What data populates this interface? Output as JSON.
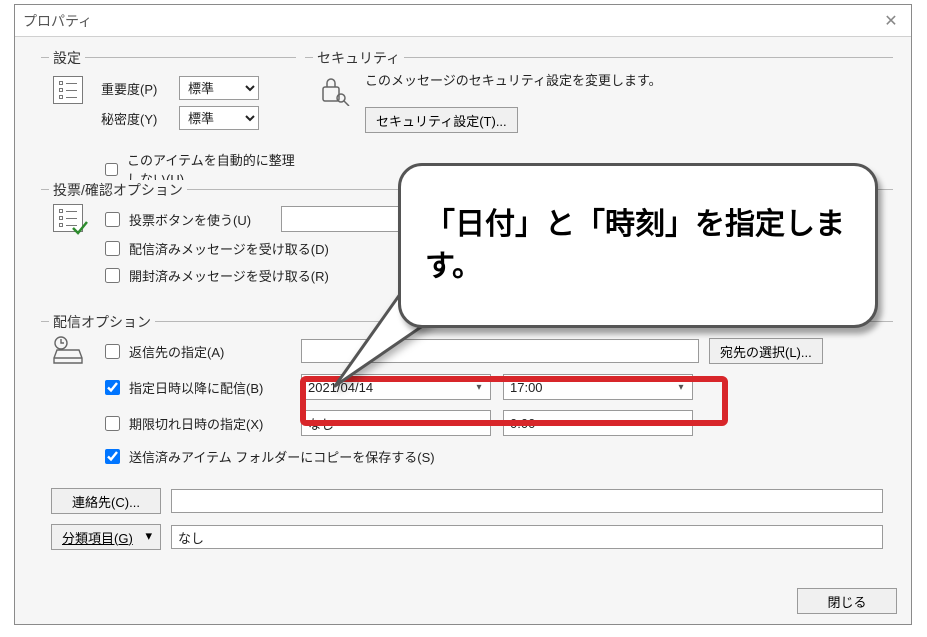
{
  "title": "プロパティ",
  "groups": {
    "settings": "設定",
    "security": "セキュリティ",
    "vote": "投票/確認オプション",
    "delivery": "配信オプション"
  },
  "settings": {
    "importance_label": "重要度(P)",
    "importance_value": "標準",
    "sensitivity_label": "秘密度(Y)",
    "sensitivity_value": "標準",
    "auto_archive": "このアイテムを自動的に整理しない(U)"
  },
  "security": {
    "desc": "このメッセージのセキュリティ設定を変更します。",
    "button": "セキュリティ設定(T)..."
  },
  "vote": {
    "use_voting": "投票ボタンを使う(U)",
    "delivery_receipt": "配信済みメッセージを受け取る(D)",
    "read_receipt": "開封済みメッセージを受け取る(R)"
  },
  "delivery": {
    "reply_to": "返信先の指定(A)",
    "defer": "指定日時以降に配信(B)",
    "defer_date": "2021/04/14",
    "defer_time": "17:00",
    "expire": "期限切れ日時の指定(X)",
    "expire_date": "なし",
    "expire_time": "0:00",
    "save_sent": "送信済みアイテム フォルダーにコピーを保存する(S)",
    "contacts_btn": "連絡先(C)...",
    "categories_btn": "分類項目(G)",
    "categories_value": "なし",
    "select_names_btn": "宛先の選択(L)..."
  },
  "close": "閉じる",
  "callout": "「日付」と「時刻」を指定します。"
}
